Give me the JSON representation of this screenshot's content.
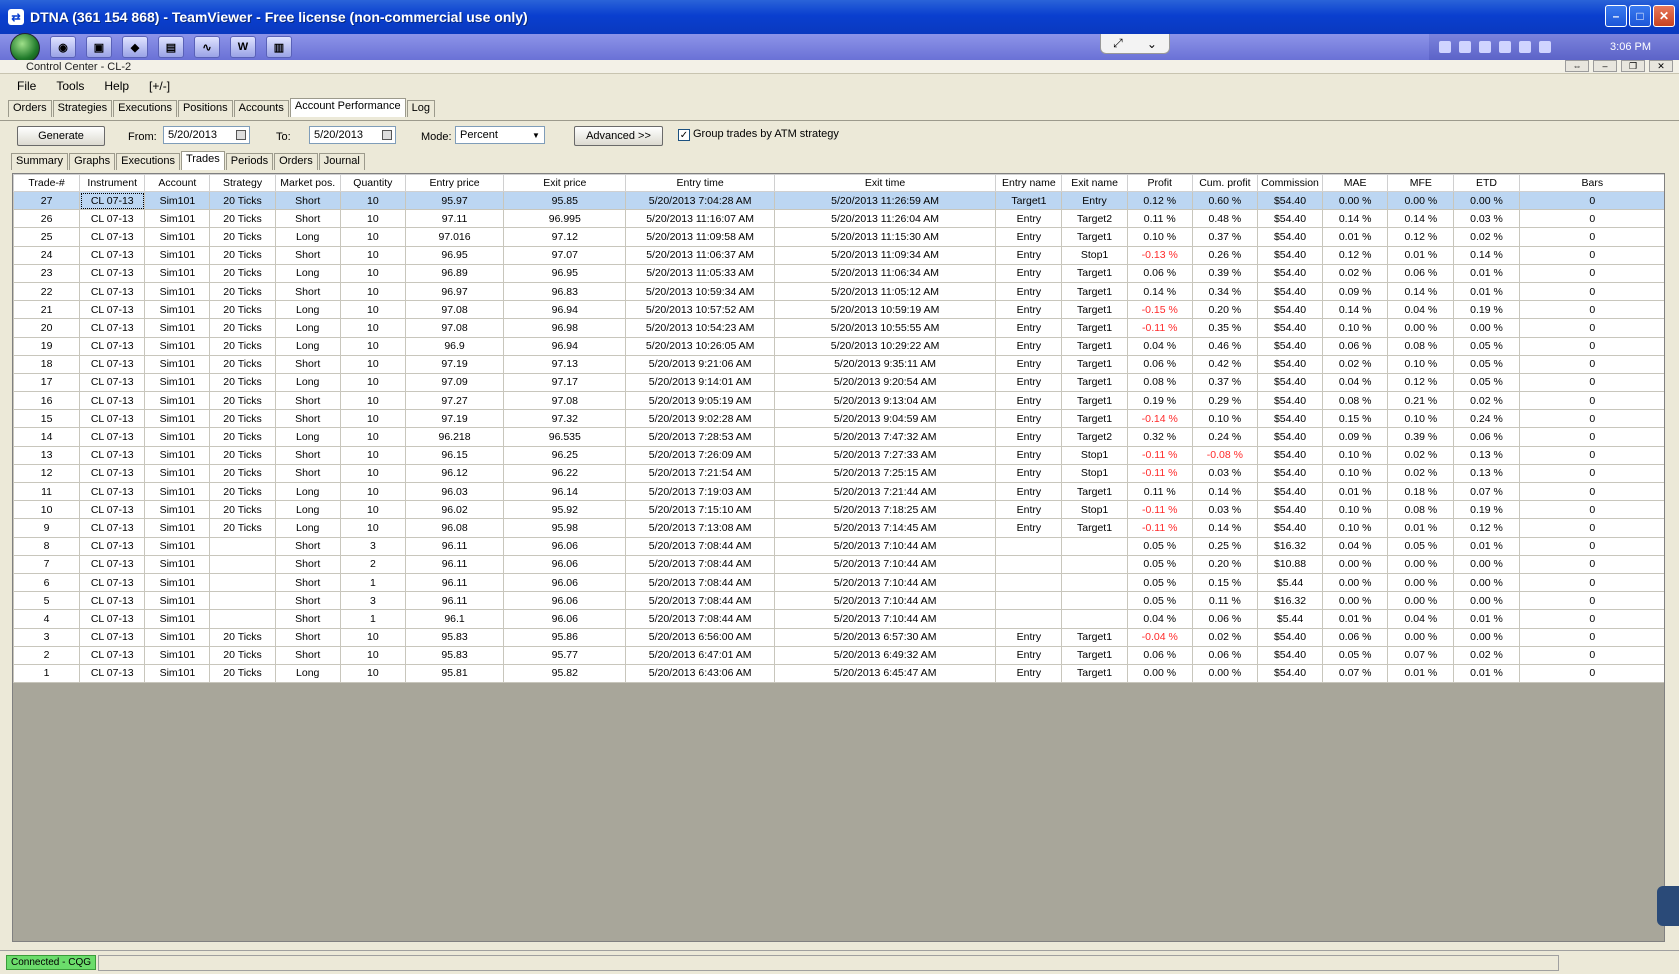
{
  "tv": {
    "title": "DTNA (361 154 868) - TeamViewer - Free license (non-commercial use only)",
    "clock": "3:06 PM"
  },
  "cc": {
    "title": "Control Center - CL-2"
  },
  "menu": [
    "File",
    "Tools",
    "Help",
    "[+/-]"
  ],
  "main_tabs": [
    "Orders",
    "Strategies",
    "Executions",
    "Positions",
    "Accounts",
    "Account Performance",
    "Log"
  ],
  "toolbar": {
    "generate": "Generate",
    "from_label": "From:",
    "from_value": "5/20/2013",
    "to_label": "To:",
    "to_value": "5/20/2013",
    "mode_label": "Mode:",
    "mode_value": "Percent",
    "advanced": "Advanced >>",
    "group_label": "Group trades by ATM strategy",
    "group_checked": true
  },
  "sub_tabs": [
    "Summary",
    "Graphs",
    "Executions",
    "Trades",
    "Periods",
    "Orders",
    "Journal"
  ],
  "columns": [
    "Trade-#",
    "Instrument",
    "Account",
    "Strategy",
    "Market pos.",
    "Quantity",
    "Entry price",
    "Exit price",
    "Entry time",
    "Exit time",
    "Entry name",
    "Exit name",
    "Profit",
    "Cum. profit",
    "Commission",
    "MAE",
    "MFE",
    "ETD",
    "Bars"
  ],
  "rows": [
    [
      "27",
      "CL 07-13",
      "Sim101",
      "20 Ticks",
      "Short",
      "10",
      "95.97",
      "95.85",
      "5/20/2013 7:04:28 AM",
      "5/20/2013 11:26:59 AM",
      "Target1",
      "Entry",
      "0.12 %",
      "0.60 %",
      "$54.40",
      "0.00 %",
      "0.00 %",
      "0.00 %",
      "0"
    ],
    [
      "26",
      "CL 07-13",
      "Sim101",
      "20 Ticks",
      "Short",
      "10",
      "97.11",
      "96.995",
      "5/20/2013 11:16:07 AM",
      "5/20/2013 11:26:04 AM",
      "Entry",
      "Target2",
      "0.11 %",
      "0.48 %",
      "$54.40",
      "0.14 %",
      "0.14 %",
      "0.03 %",
      "0"
    ],
    [
      "25",
      "CL 07-13",
      "Sim101",
      "20 Ticks",
      "Long",
      "10",
      "97.016",
      "97.12",
      "5/20/2013 11:09:58 AM",
      "5/20/2013 11:15:30 AM",
      "Entry",
      "Target1",
      "0.10 %",
      "0.37 %",
      "$54.40",
      "0.01 %",
      "0.12 %",
      "0.02 %",
      "0"
    ],
    [
      "24",
      "CL 07-13",
      "Sim101",
      "20 Ticks",
      "Short",
      "10",
      "96.95",
      "97.07",
      "5/20/2013 11:06:37 AM",
      "5/20/2013 11:09:34 AM",
      "Entry",
      "Stop1",
      "-0.13 %",
      "0.26 %",
      "$54.40",
      "0.12 %",
      "0.01 %",
      "0.14 %",
      "0"
    ],
    [
      "23",
      "CL 07-13",
      "Sim101",
      "20 Ticks",
      "Long",
      "10",
      "96.89",
      "96.95",
      "5/20/2013 11:05:33 AM",
      "5/20/2013 11:06:34 AM",
      "Entry",
      "Target1",
      "0.06 %",
      "0.39 %",
      "$54.40",
      "0.02 %",
      "0.06 %",
      "0.01 %",
      "0"
    ],
    [
      "22",
      "CL 07-13",
      "Sim101",
      "20 Ticks",
      "Short",
      "10",
      "96.97",
      "96.83",
      "5/20/2013 10:59:34 AM",
      "5/20/2013 11:05:12 AM",
      "Entry",
      "Target1",
      "0.14 %",
      "0.34 %",
      "$54.40",
      "0.09 %",
      "0.14 %",
      "0.01 %",
      "0"
    ],
    [
      "21",
      "CL 07-13",
      "Sim101",
      "20 Ticks",
      "Long",
      "10",
      "97.08",
      "96.94",
      "5/20/2013 10:57:52 AM",
      "5/20/2013 10:59:19 AM",
      "Entry",
      "Target1",
      "-0.15 %",
      "0.20 %",
      "$54.40",
      "0.14 %",
      "0.04 %",
      "0.19 %",
      "0"
    ],
    [
      "20",
      "CL 07-13",
      "Sim101",
      "20 Ticks",
      "Long",
      "10",
      "97.08",
      "96.98",
      "5/20/2013 10:54:23 AM",
      "5/20/2013 10:55:55 AM",
      "Entry",
      "Target1",
      "-0.11 %",
      "0.35 %",
      "$54.40",
      "0.10 %",
      "0.00 %",
      "0.00 %",
      "0"
    ],
    [
      "19",
      "CL 07-13",
      "Sim101",
      "20 Ticks",
      "Long",
      "10",
      "96.9",
      "96.94",
      "5/20/2013 10:26:05 AM",
      "5/20/2013 10:29:22 AM",
      "Entry",
      "Target1",
      "0.04 %",
      "0.46 %",
      "$54.40",
      "0.06 %",
      "0.08 %",
      "0.05 %",
      "0"
    ],
    [
      "18",
      "CL 07-13",
      "Sim101",
      "20 Ticks",
      "Short",
      "10",
      "97.19",
      "97.13",
      "5/20/2013 9:21:06 AM",
      "5/20/2013 9:35:11 AM",
      "Entry",
      "Target1",
      "0.06 %",
      "0.42 %",
      "$54.40",
      "0.02 %",
      "0.10 %",
      "0.05 %",
      "0"
    ],
    [
      "17",
      "CL 07-13",
      "Sim101",
      "20 Ticks",
      "Long",
      "10",
      "97.09",
      "97.17",
      "5/20/2013 9:14:01 AM",
      "5/20/2013 9:20:54 AM",
      "Entry",
      "Target1",
      "0.08 %",
      "0.37 %",
      "$54.40",
      "0.04 %",
      "0.12 %",
      "0.05 %",
      "0"
    ],
    [
      "16",
      "CL 07-13",
      "Sim101",
      "20 Ticks",
      "Short",
      "10",
      "97.27",
      "97.08",
      "5/20/2013 9:05:19 AM",
      "5/20/2013 9:13:04 AM",
      "Entry",
      "Target1",
      "0.19 %",
      "0.29 %",
      "$54.40",
      "0.08 %",
      "0.21 %",
      "0.02 %",
      "0"
    ],
    [
      "15",
      "CL 07-13",
      "Sim101",
      "20 Ticks",
      "Short",
      "10",
      "97.19",
      "97.32",
      "5/20/2013 9:02:28 AM",
      "5/20/2013 9:04:59 AM",
      "Entry",
      "Target1",
      "-0.14 %",
      "0.10 %",
      "$54.40",
      "0.15 %",
      "0.10 %",
      "0.24 %",
      "0"
    ],
    [
      "14",
      "CL 07-13",
      "Sim101",
      "20 Ticks",
      "Long",
      "10",
      "96.218",
      "96.535",
      "5/20/2013 7:28:53 AM",
      "5/20/2013 7:47:32 AM",
      "Entry",
      "Target2",
      "0.32 %",
      "0.24 %",
      "$54.40",
      "0.09 %",
      "0.39 %",
      "0.06 %",
      "0"
    ],
    [
      "13",
      "CL 07-13",
      "Sim101",
      "20 Ticks",
      "Short",
      "10",
      "96.15",
      "96.25",
      "5/20/2013 7:26:09 AM",
      "5/20/2013 7:27:33 AM",
      "Entry",
      "Stop1",
      "-0.11 %",
      "-0.08 %",
      "$54.40",
      "0.10 %",
      "0.02 %",
      "0.13 %",
      "0"
    ],
    [
      "12",
      "CL 07-13",
      "Sim101",
      "20 Ticks",
      "Short",
      "10",
      "96.12",
      "96.22",
      "5/20/2013 7:21:54 AM",
      "5/20/2013 7:25:15 AM",
      "Entry",
      "Stop1",
      "-0.11 %",
      "0.03 %",
      "$54.40",
      "0.10 %",
      "0.02 %",
      "0.13 %",
      "0"
    ],
    [
      "11",
      "CL 07-13",
      "Sim101",
      "20 Ticks",
      "Long",
      "10",
      "96.03",
      "96.14",
      "5/20/2013 7:19:03 AM",
      "5/20/2013 7:21:44 AM",
      "Entry",
      "Target1",
      "0.11 %",
      "0.14 %",
      "$54.40",
      "0.01 %",
      "0.18 %",
      "0.07 %",
      "0"
    ],
    [
      "10",
      "CL 07-13",
      "Sim101",
      "20 Ticks",
      "Long",
      "10",
      "96.02",
      "95.92",
      "5/20/2013 7:15:10 AM",
      "5/20/2013 7:18:25 AM",
      "Entry",
      "Stop1",
      "-0.11 %",
      "0.03 %",
      "$54.40",
      "0.10 %",
      "0.08 %",
      "0.19 %",
      "0"
    ],
    [
      "9",
      "CL 07-13",
      "Sim101",
      "20 Ticks",
      "Long",
      "10",
      "96.08",
      "95.98",
      "5/20/2013 7:13:08 AM",
      "5/20/2013 7:14:45 AM",
      "Entry",
      "Target1",
      "-0.11 %",
      "0.14 %",
      "$54.40",
      "0.10 %",
      "0.01 %",
      "0.12 %",
      "0"
    ],
    [
      "8",
      "CL 07-13",
      "Sim101",
      "",
      "Short",
      "3",
      "96.11",
      "96.06",
      "5/20/2013 7:08:44 AM",
      "5/20/2013 7:10:44 AM",
      "",
      "",
      "0.05 %",
      "0.25 %",
      "$16.32",
      "0.04 %",
      "0.05 %",
      "0.01 %",
      "0"
    ],
    [
      "7",
      "CL 07-13",
      "Sim101",
      "",
      "Short",
      "2",
      "96.11",
      "96.06",
      "5/20/2013 7:08:44 AM",
      "5/20/2013 7:10:44 AM",
      "",
      "",
      "0.05 %",
      "0.20 %",
      "$10.88",
      "0.00 %",
      "0.00 %",
      "0.00 %",
      "0"
    ],
    [
      "6",
      "CL 07-13",
      "Sim101",
      "",
      "Short",
      "1",
      "96.11",
      "96.06",
      "5/20/2013 7:08:44 AM",
      "5/20/2013 7:10:44 AM",
      "",
      "",
      "0.05 %",
      "0.15 %",
      "$5.44",
      "0.00 %",
      "0.00 %",
      "0.00 %",
      "0"
    ],
    [
      "5",
      "CL 07-13",
      "Sim101",
      "",
      "Short",
      "3",
      "96.11",
      "96.06",
      "5/20/2013 7:08:44 AM",
      "5/20/2013 7:10:44 AM",
      "",
      "",
      "0.05 %",
      "0.11 %",
      "$16.32",
      "0.00 %",
      "0.00 %",
      "0.00 %",
      "0"
    ],
    [
      "4",
      "CL 07-13",
      "Sim101",
      "",
      "Short",
      "1",
      "96.1",
      "96.06",
      "5/20/2013 7:08:44 AM",
      "5/20/2013 7:10:44 AM",
      "",
      "",
      "0.04 %",
      "0.06 %",
      "$5.44",
      "0.01 %",
      "0.04 %",
      "0.01 %",
      "0"
    ],
    [
      "3",
      "CL 07-13",
      "Sim101",
      "20 Ticks",
      "Short",
      "10",
      "95.83",
      "95.86",
      "5/20/2013 6:56:00 AM",
      "5/20/2013 6:57:30 AM",
      "Entry",
      "Target1",
      "-0.04 %",
      "0.02 %",
      "$54.40",
      "0.06 %",
      "0.00 %",
      "0.00 %",
      "0"
    ],
    [
      "2",
      "CL 07-13",
      "Sim101",
      "20 Ticks",
      "Short",
      "10",
      "95.83",
      "95.77",
      "5/20/2013 6:47:01 AM",
      "5/20/2013 6:49:32 AM",
      "Entry",
      "Target1",
      "0.06 %",
      "0.06 %",
      "$54.40",
      "0.05 %",
      "0.07 %",
      "0.02 %",
      "0"
    ],
    [
      "1",
      "CL 07-13",
      "Sim101",
      "20 Ticks",
      "Long",
      "10",
      "95.81",
      "95.82",
      "5/20/2013 6:43:06 AM",
      "5/20/2013 6:45:47 AM",
      "Entry",
      "Target1",
      "0.00 %",
      "0.00 %",
      "$54.40",
      "0.07 %",
      "0.01 %",
      "0.01 %",
      "0"
    ]
  ],
  "status": "Connected - CQG",
  "colors": {
    "selected_row": "#bcd6f2",
    "negative": "#ff2a2a",
    "status_green": "#6bdc6b"
  }
}
